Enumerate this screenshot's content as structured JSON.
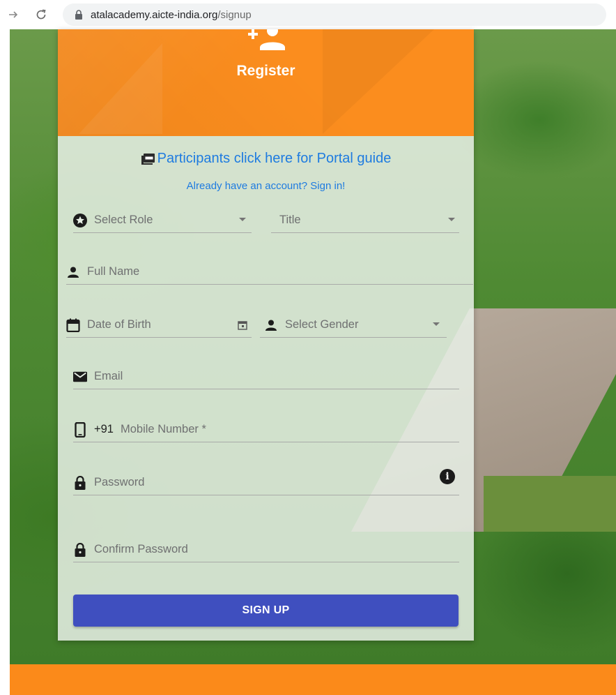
{
  "browser": {
    "url_host": "atalacademy.aicte-india.org",
    "url_path": "/signup"
  },
  "card": {
    "title": "Register",
    "guide_link": "Participants click here for Portal guide",
    "signin_link": "Already have an account? Sign in!"
  },
  "form": {
    "role_placeholder": "Select Role",
    "title_placeholder": "Title",
    "full_name_placeholder": "Full Name",
    "dob_placeholder": "Date of Birth",
    "gender_placeholder": "Select Gender",
    "email_placeholder": "Email",
    "mobile_prefix": "+91",
    "mobile_placeholder": "Mobile Number *",
    "password_placeholder": "Password",
    "confirm_password_placeholder": "Confirm Password",
    "info_glyph": "i",
    "submit_label": "SIGN UP"
  },
  "colors": {
    "header_orange": "#fb8d1e",
    "link_blue": "#1e7be0",
    "button_indigo": "#3f4fbf"
  }
}
